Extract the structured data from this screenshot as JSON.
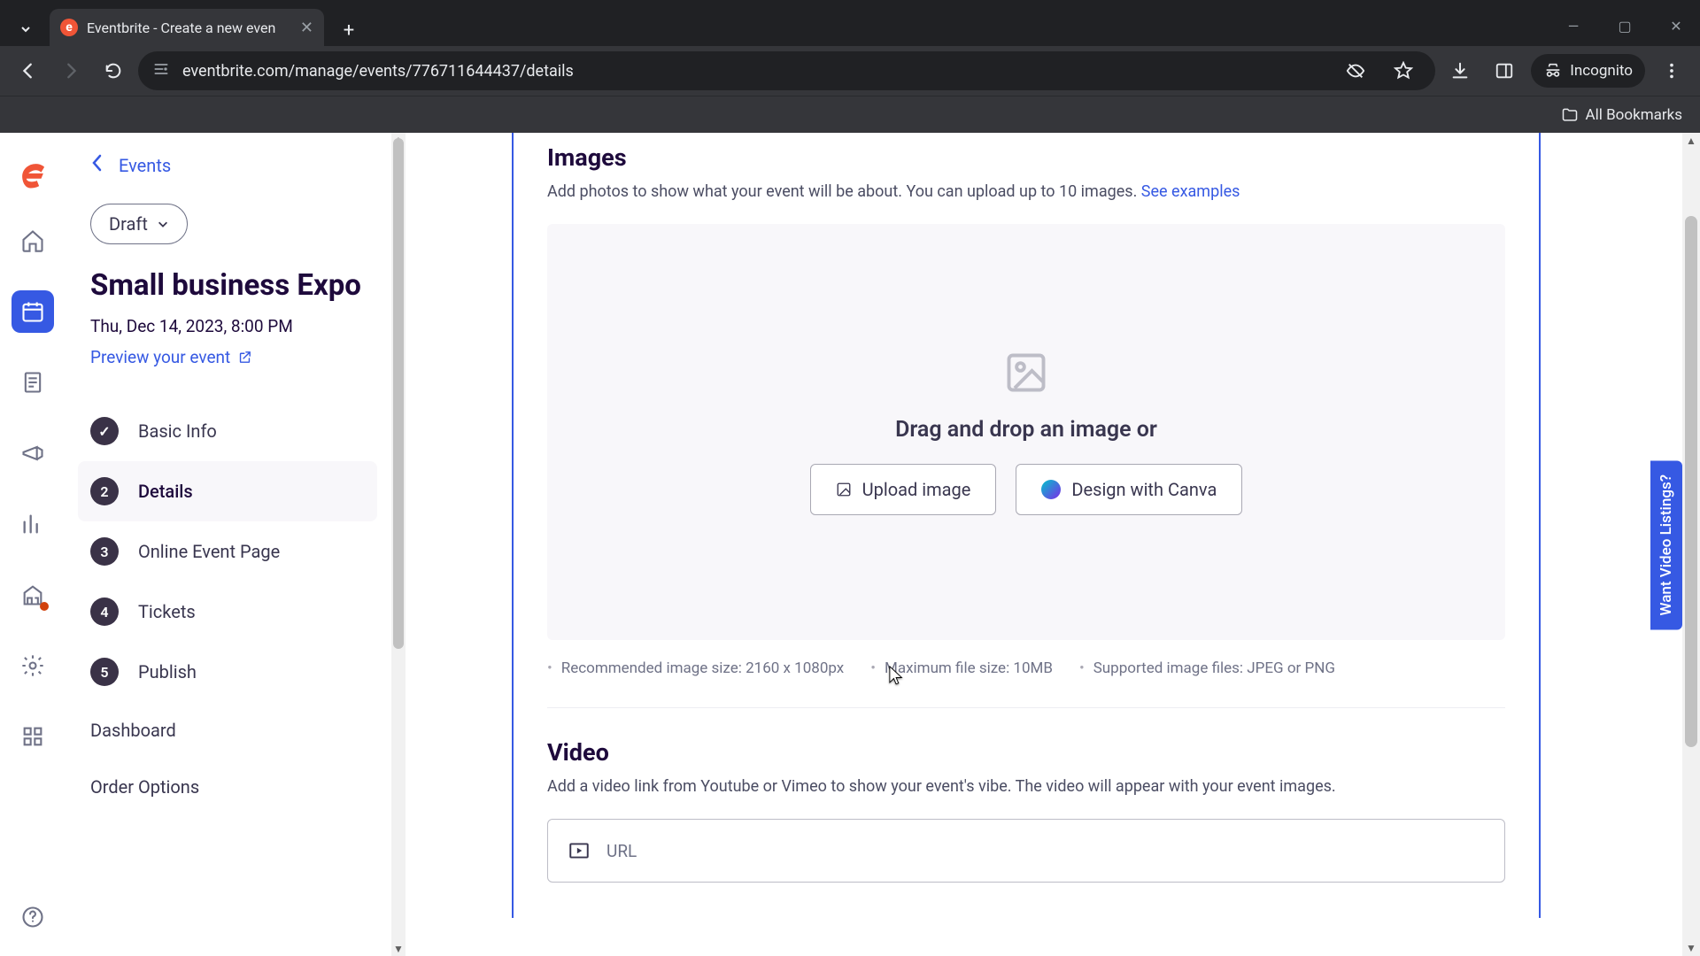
{
  "browser": {
    "tab_title": "Eventbrite - Create a new even",
    "url": "eventbrite.com/manage/events/776711644437/details",
    "incognito_label": "Incognito",
    "bookmarks_label": "All Bookmarks"
  },
  "sidebar": {
    "back_label": "Events",
    "status_pill": "Draft",
    "event_title": "Small business Expo",
    "event_date": "Thu, Dec 14, 2023, 8:00 PM",
    "preview_label": "Preview your event",
    "steps": [
      {
        "num": "✓",
        "label": "Basic Info",
        "state": "done"
      },
      {
        "num": "2",
        "label": "Details",
        "state": "active"
      },
      {
        "num": "3",
        "label": "Online Event Page",
        "state": ""
      },
      {
        "num": "4",
        "label": "Tickets",
        "state": ""
      },
      {
        "num": "5",
        "label": "Publish",
        "state": ""
      }
    ],
    "extra_links": [
      "Dashboard",
      "Order Options"
    ]
  },
  "main": {
    "images": {
      "heading": "Images",
      "description": "Add photos to show what your event will be about. You can upload up to 10 images. ",
      "link_text": "See examples",
      "dropzone_text": "Drag and drop an image or",
      "upload_btn": "Upload image",
      "canva_btn": "Design with Canva",
      "hints": [
        "Recommended image size: 2160 x 1080px",
        "Maximum file size: 10MB",
        "Supported image files: JPEG or PNG"
      ]
    },
    "video": {
      "heading": "Video",
      "description": "Add a video link from Youtube or Vimeo to show your event's vibe. The video will appear with your event images.",
      "url_label": "URL"
    }
  },
  "side_tab": "Want Video Listings?"
}
